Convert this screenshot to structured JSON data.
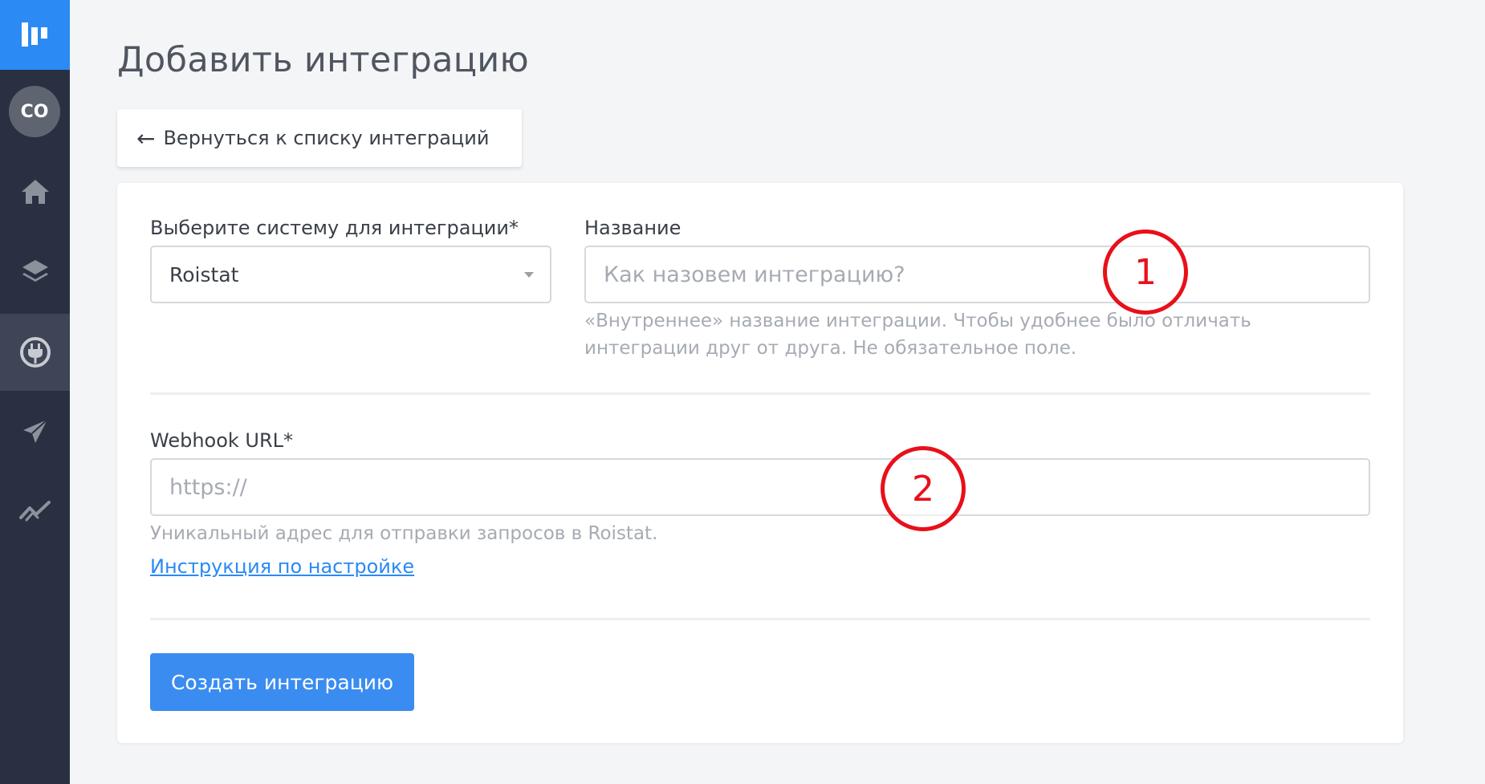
{
  "sidebar": {
    "avatar_initials": "CO",
    "items": [
      {
        "icon": "home-icon",
        "active": false
      },
      {
        "icon": "layers-icon",
        "active": false
      },
      {
        "icon": "plug-icon",
        "active": true
      },
      {
        "icon": "send-icon",
        "active": false
      },
      {
        "icon": "chart-icon",
        "active": false
      }
    ],
    "colors": {
      "background": "#293042",
      "logo_bg": "#2b8af4",
      "active_bg": "#3e4556"
    }
  },
  "page": {
    "title": "Добавить интеграцию",
    "back_button": "Вернуться к списку интеграций"
  },
  "form": {
    "system_label": "Выберите систему для интеграции*",
    "system_value": "Roistat",
    "name_label": "Название",
    "name_placeholder": "Как назовем интеграцию?",
    "name_hint": "«Внутреннее» название интеграции. Чтобы удобнее было отличать интеграции друг от друга. Не обязательное поле.",
    "webhook_label": "Webhook URL*",
    "webhook_placeholder": "https://",
    "webhook_hint": "Уникальный адрес для отправки запросов в Roistat.",
    "instructions_link": "Инструкция по настройке",
    "submit_label": "Создать интеграцию"
  },
  "annotations": {
    "marker_1": "1",
    "marker_2": "2",
    "color": "#e8101a"
  },
  "colors": {
    "accent": "#3b8cf0",
    "link": "#2b8af4"
  }
}
